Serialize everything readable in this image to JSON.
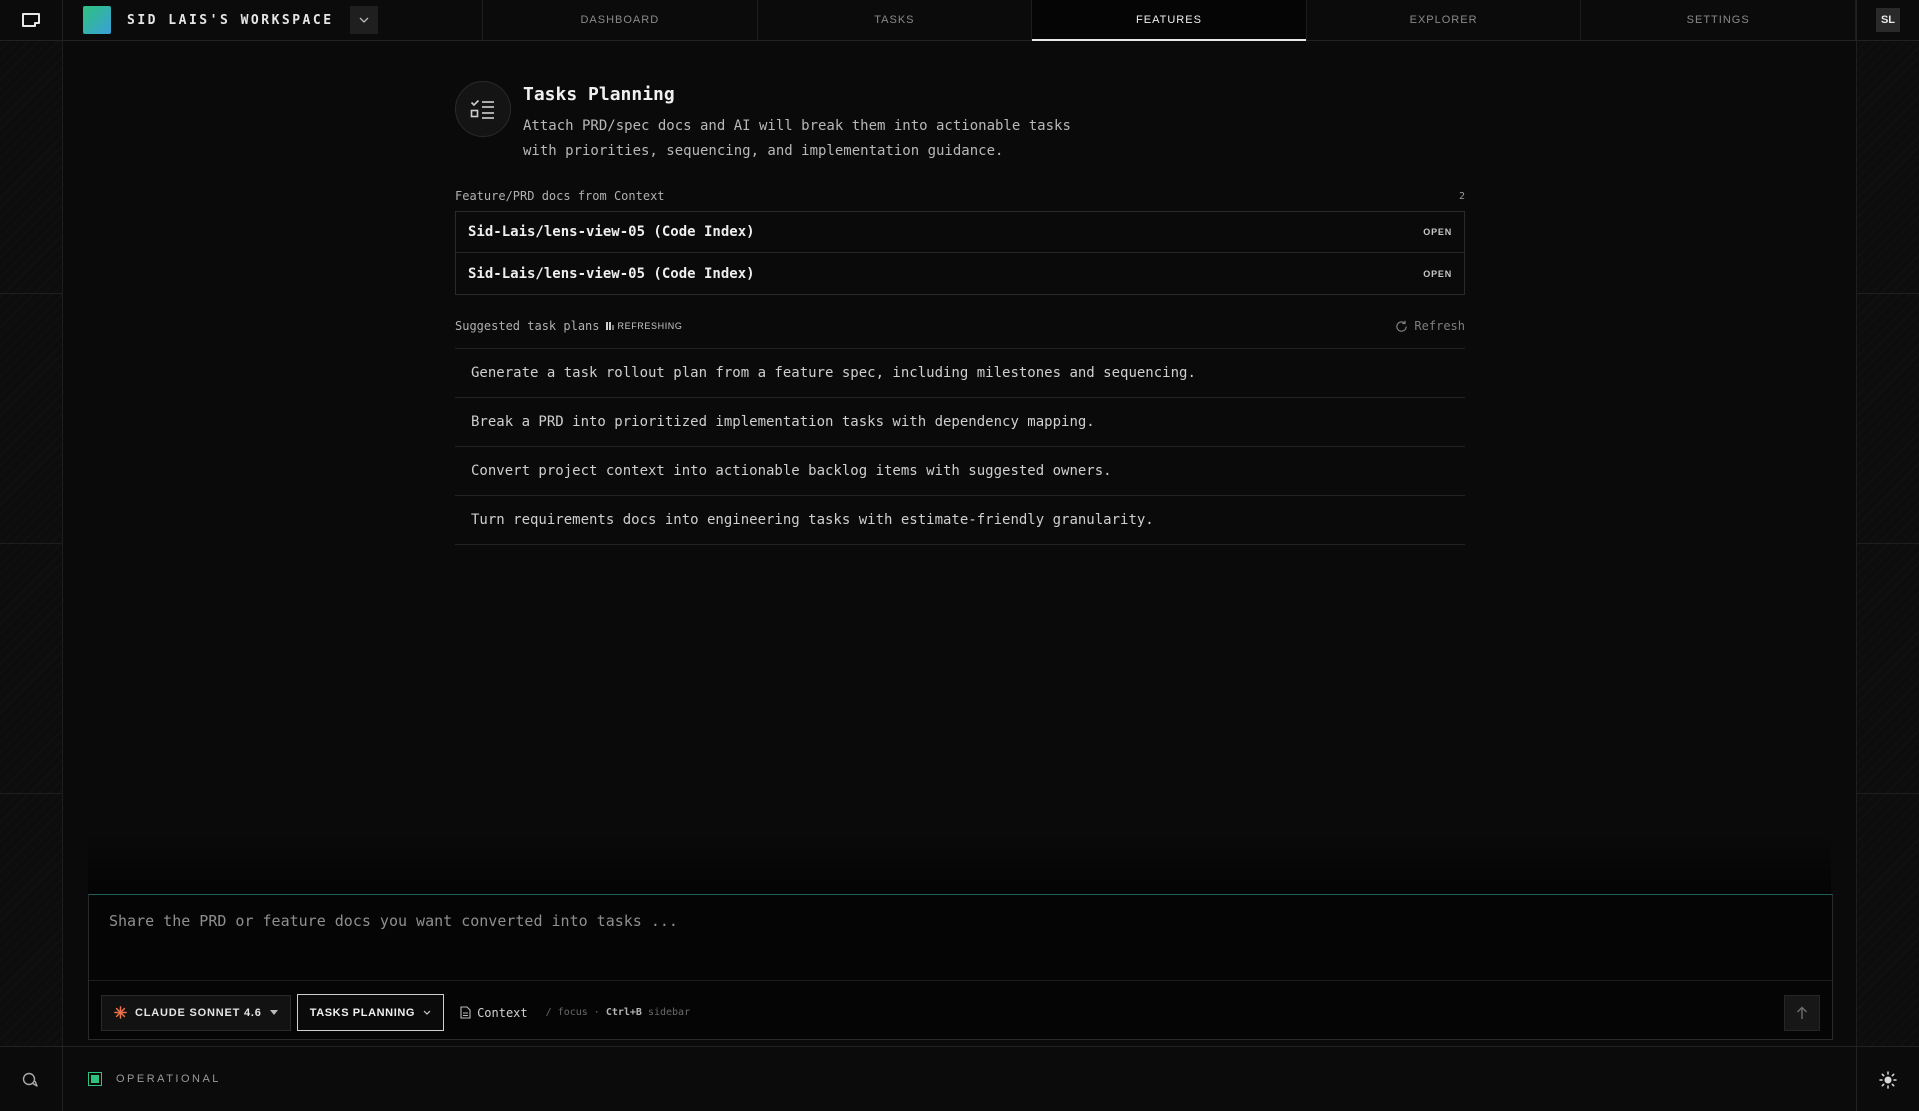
{
  "workspace": {
    "name": "SID LAIS'S WORKSPACE"
  },
  "nav": {
    "tabs": [
      {
        "label": "DASHBOARD"
      },
      {
        "label": "TASKS"
      },
      {
        "label": "FEATURES"
      },
      {
        "label": "EXPLORER"
      },
      {
        "label": "SETTINGS"
      }
    ],
    "active": "FEATURES"
  },
  "user": {
    "initials": "SL"
  },
  "feature": {
    "icon": "list-check-icon",
    "title": "Tasks Planning",
    "description": "Attach PRD/spec docs and AI will break them into actionable tasks with priorities, sequencing, and implementation guidance."
  },
  "docs": {
    "label": "Feature/PRD docs from Context",
    "count": "2",
    "items": [
      {
        "name": "Sid-Lais/lens-view-05 (Code Index)",
        "action": "OPEN"
      },
      {
        "name": "Sid-Lais/lens-view-05 (Code Index)",
        "action": "OPEN"
      }
    ]
  },
  "suggestions": {
    "label": "Suggested task plans",
    "status": "REFRESHING",
    "refresh_label": "Refresh",
    "items": [
      "Generate a task rollout plan from a feature spec, including milestones and sequencing.",
      "Break a PRD into prioritized implementation tasks with dependency mapping.",
      "Convert project context into actionable backlog items with suggested owners.",
      "Turn requirements docs into engineering tasks with estimate-friendly granularity."
    ]
  },
  "composer": {
    "placeholder": "Share the PRD or feature docs you want converted into tasks ...",
    "model_label": "CLAUDE SONNET 4.6",
    "mode_label": "TASKS PLANNING",
    "context_label": "Context",
    "hint_focus": "/ focus",
    "hint_key": "Ctrl+B",
    "hint_sidebar": "sidebar"
  },
  "footer": {
    "status": "OPERATIONAL"
  },
  "colors": {
    "accent": "#2ec27e",
    "model_icon": "#e8734a",
    "focus_line": "#1f5f5a"
  }
}
